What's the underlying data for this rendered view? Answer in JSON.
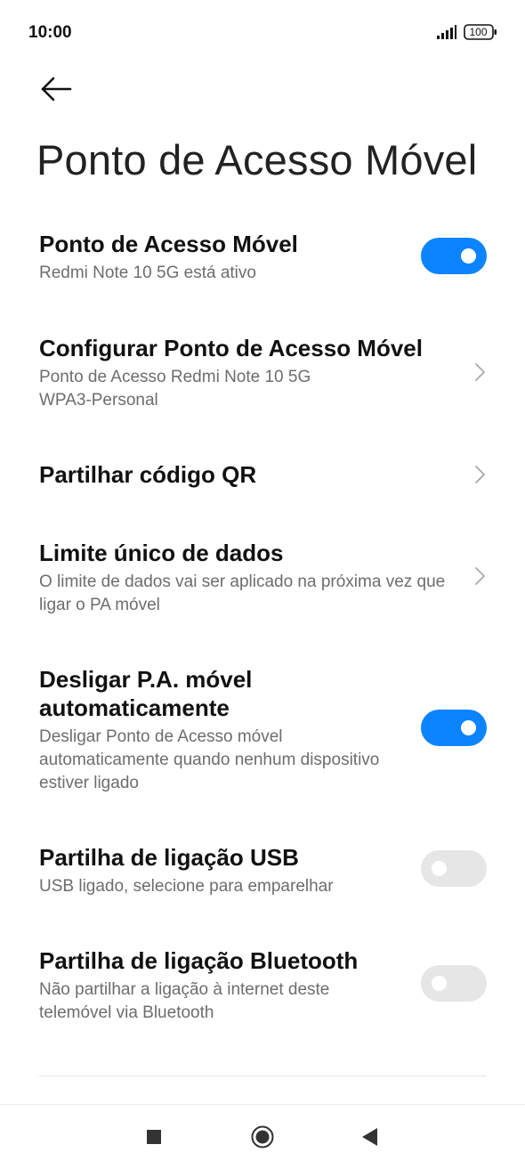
{
  "status_bar": {
    "time": "10:00",
    "battery": "100",
    "signal_icon": "signal-bars-icon",
    "battery_icon": "battery-icon"
  },
  "header": {
    "back_icon": "arrow-left-icon",
    "title": "Ponto de Acesso Móvel"
  },
  "settings": [
    {
      "title": "Ponto de Acesso Móvel",
      "subtitle": "Redmi Note 10 5G está ativo",
      "control": "toggle",
      "state": true
    },
    {
      "title": "Configurar Ponto de Acesso Móvel",
      "subtitle_line1": "Ponto de Acesso Redmi Note 10 5G",
      "subtitle_line2": "WPA3-Personal",
      "control": "chevron"
    },
    {
      "title": "Partilhar código QR",
      "control": "chevron"
    },
    {
      "title": "Limite único de dados",
      "subtitle": "O limite de dados vai ser aplicado na próxima vez que ligar o PA móvel",
      "control": "chevron"
    },
    {
      "title": "Desligar P.A. móvel automaticamente",
      "subtitle": "Desligar Ponto de Acesso móvel automaticamente quando nenhum dispositivo estiver ligado",
      "control": "toggle",
      "state": true
    },
    {
      "title": "Partilha de ligação USB",
      "subtitle": "USB ligado, selecione para emparelhar",
      "control": "toggle",
      "state": false
    },
    {
      "title": "Partilha de ligação Bluetooth",
      "subtitle": "Não partilhar a ligação à internet deste telemóvel via Bluetooth",
      "control": "toggle",
      "state": false
    }
  ],
  "colors": {
    "accent": "#0d84ff",
    "toggle_off": "#e6e6e6",
    "subtitle": "#6d6d6d"
  },
  "nav_bar": {
    "recents_icon": "square-recents-icon",
    "home_icon": "circle-home-icon",
    "back_icon": "triangle-back-icon"
  }
}
